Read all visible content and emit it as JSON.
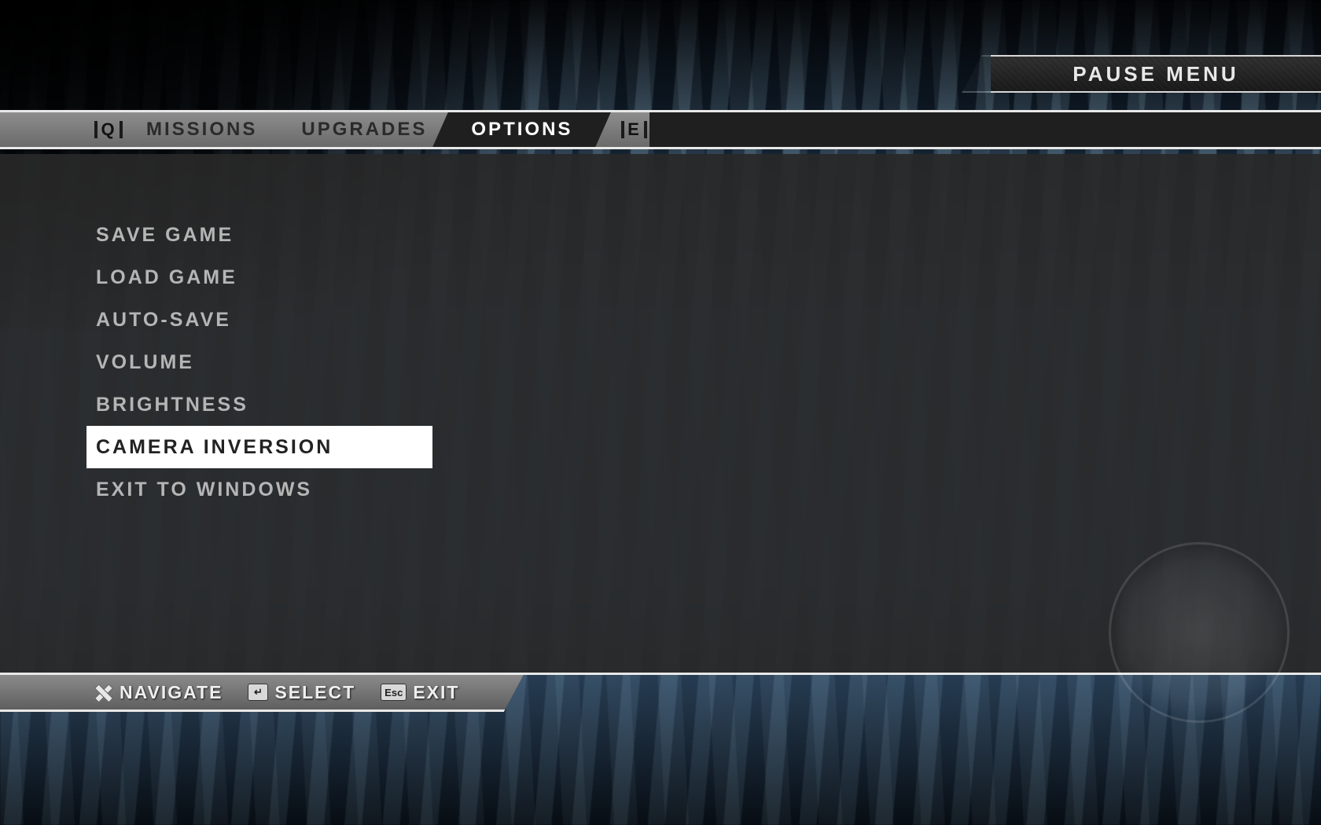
{
  "header": {
    "title": "PAUSE MENU"
  },
  "tabs": {
    "prev_key": "Q",
    "next_key": "E",
    "items": [
      {
        "label": "MISSIONS",
        "selected": false
      },
      {
        "label": "UPGRADES",
        "selected": false
      },
      {
        "label": "OPTIONS",
        "selected": true
      }
    ]
  },
  "options": {
    "items": [
      {
        "label": "SAVE GAME",
        "selected": false
      },
      {
        "label": "LOAD GAME",
        "selected": false
      },
      {
        "label": "AUTO-SAVE",
        "selected": false
      },
      {
        "label": "VOLUME",
        "selected": false
      },
      {
        "label": "BRIGHTNESS",
        "selected": false
      },
      {
        "label": "CAMERA INVERSION",
        "selected": true
      },
      {
        "label": "EXIT TO WINDOWS",
        "selected": false
      }
    ]
  },
  "footer": {
    "navigate_label": "NAVIGATE",
    "select_label": "SELECT",
    "select_key": "↵",
    "exit_label": "EXIT",
    "exit_key": "Esc"
  }
}
